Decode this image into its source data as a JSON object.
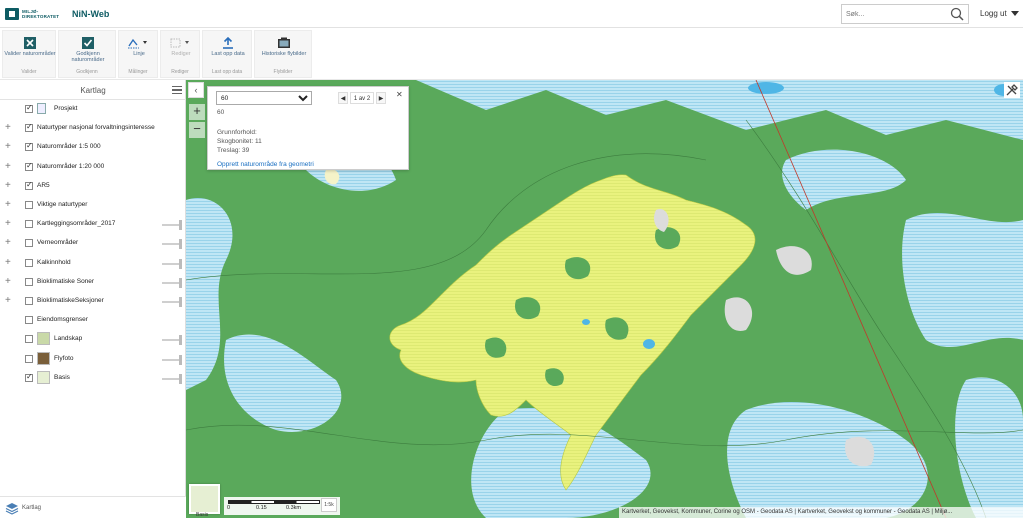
{
  "header": {
    "logo_text_line1": "MILJØ-",
    "logo_text_line2": "DIREKTORATET",
    "app_title": "NiN-Web",
    "search_placeholder": "Søk...",
    "logout_label": "Logg ut"
  },
  "toolbar": {
    "valider": {
      "label": "Valider naturområder",
      "caption": "Valider"
    },
    "godkjenn": {
      "label": "Godkjenn naturområder",
      "caption": "Godkjenn"
    },
    "linje": {
      "label": "Linje",
      "caption": "Målinger"
    },
    "rediger": {
      "label": "Rediger",
      "caption": "Rediger"
    },
    "lastopp": {
      "label": "Last opp data",
      "caption": "Last opp data"
    },
    "historiske": {
      "label": "Historiske flybilder",
      "caption": "Flybilder"
    }
  },
  "panel": {
    "title": "Kartlag",
    "layers": [
      {
        "label": "Prosjekt",
        "checked": true,
        "expandable": false
      },
      {
        "label": "Naturtyper nasjonal forvaltningsinteresse",
        "checked": true,
        "expandable": true
      },
      {
        "label": "Naturområder 1:5 000",
        "checked": true,
        "expandable": true
      },
      {
        "label": "Naturområder 1:20 000",
        "checked": true,
        "expandable": true
      },
      {
        "label": "AR5",
        "checked": true,
        "expandable": true
      },
      {
        "label": "Viktige naturtyper",
        "checked": false,
        "expandable": true
      },
      {
        "label": "Kartleggingsområder_2017",
        "checked": false,
        "expandable": true
      },
      {
        "label": "Verneområder",
        "checked": false,
        "expandable": true
      },
      {
        "label": "Kalkinnhold",
        "checked": false,
        "expandable": true
      },
      {
        "label": "Bioklimatiske Soner",
        "checked": false,
        "expandable": true
      },
      {
        "label": "BioklimatiskeSeksjoner",
        "checked": false,
        "expandable": true
      },
      {
        "label": "Eiendomsgrenser",
        "checked": false,
        "expandable": false
      },
      {
        "label": "Landskap",
        "checked": false,
        "expandable": false
      },
      {
        "label": "Flyfoto",
        "checked": false,
        "expandable": false
      },
      {
        "label": "Basis",
        "checked": true,
        "expandable": false
      }
    ],
    "footer_label": "Kartlag"
  },
  "popup": {
    "selected_value": "60",
    "pager_text": "1 av 2",
    "id_value": "60",
    "heading": "Grunnforhold:",
    "line1": "Skogbonitet: 11",
    "line2": "Treslag: 39",
    "link": "Opprett naturområde fra geometri"
  },
  "map": {
    "minimap_label": "Basis",
    "scale": {
      "t0": "0",
      "t1": "0.15",
      "t2": "0.3km"
    },
    "north_label": "1:5k",
    "attribution": "Kartverket, Geovekst, Kommuner, Corine og OSM - Geodata AS | Kartverket, Geovekst og kommuner - Geodata AS | Miljø..."
  },
  "colors": {
    "forest": "#58a85a",
    "water": "#a8ddf0",
    "marsh": "#e8f28a",
    "rock": "#d9d9d9",
    "brand": "#0d5b63"
  }
}
